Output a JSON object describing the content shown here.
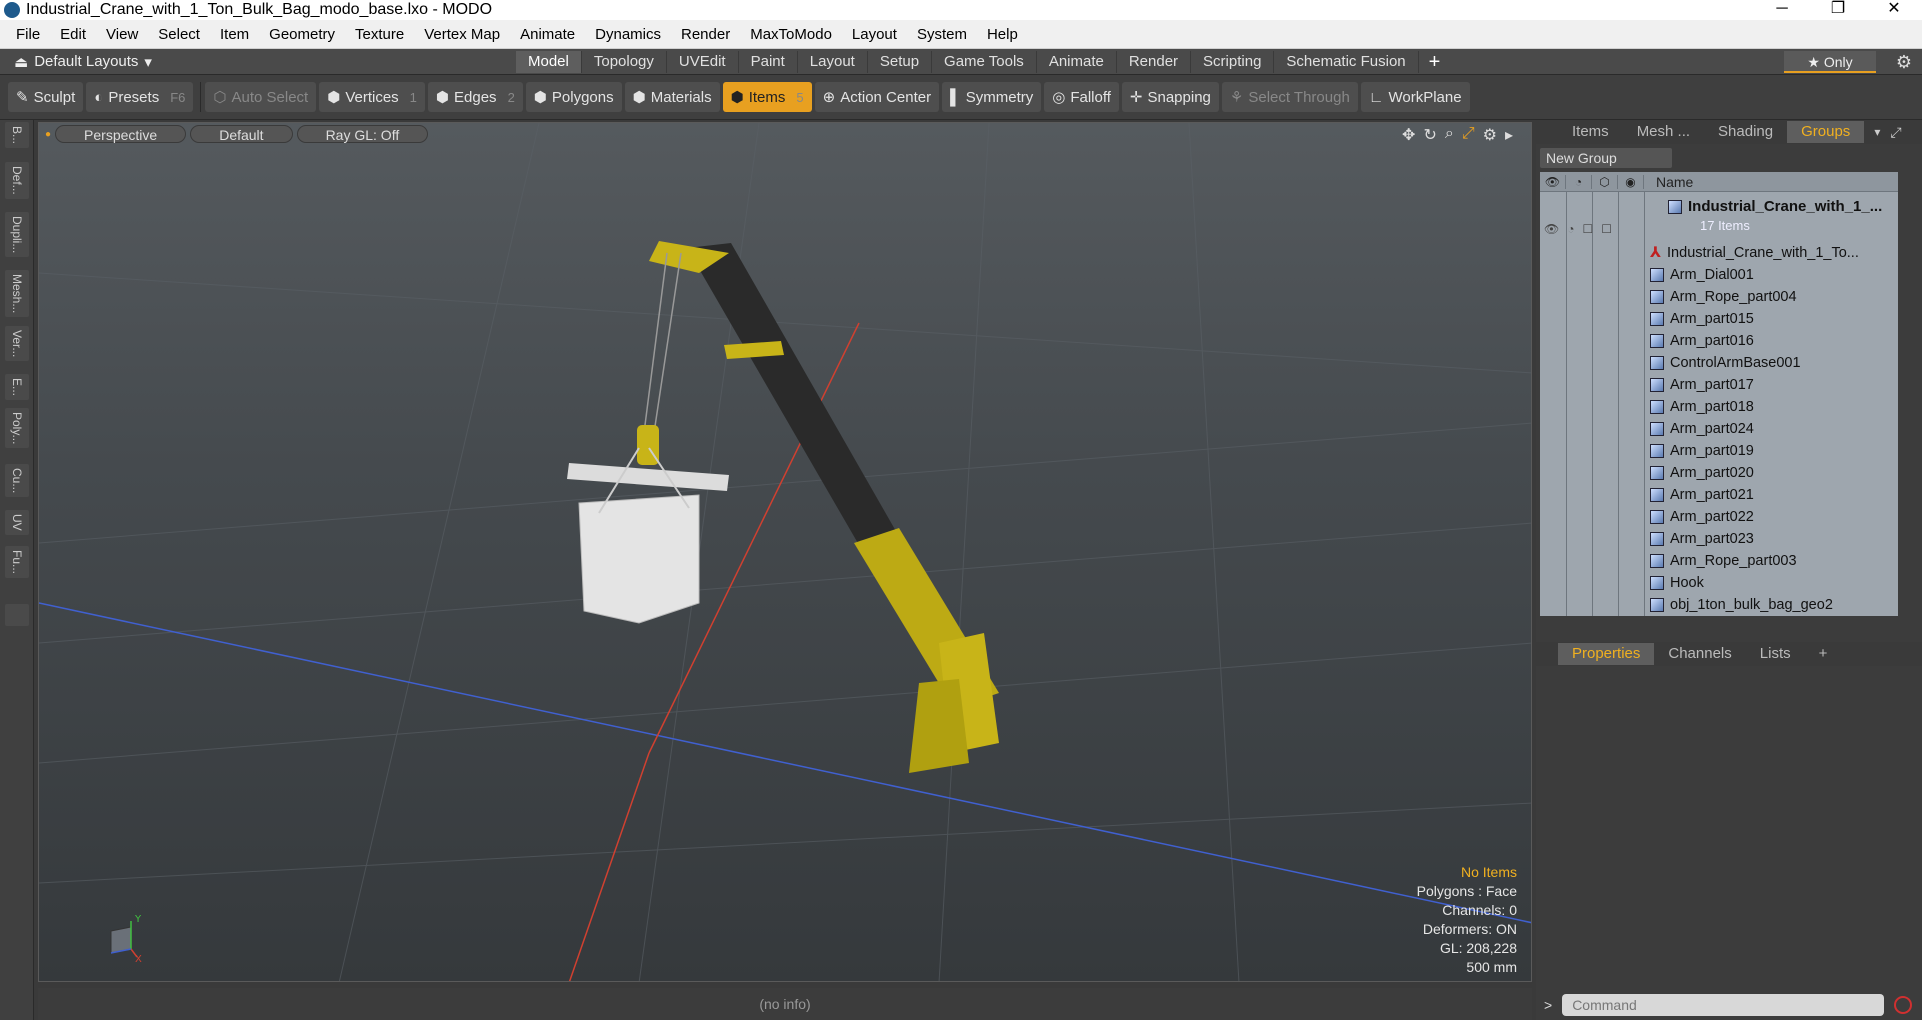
{
  "window": {
    "title": "Industrial_Crane_with_1_Ton_Bulk_Bag_modo_base.lxo - MODO",
    "minimize": "─",
    "maximize": "❐",
    "close": "✕"
  },
  "menu": [
    "File",
    "Edit",
    "View",
    "Select",
    "Item",
    "Geometry",
    "Texture",
    "Vertex Map",
    "Animate",
    "Dynamics",
    "Render",
    "MaxToModo",
    "Layout",
    "System",
    "Help"
  ],
  "layoutbar": {
    "layouts_label": "Default Layouts",
    "tabs": [
      "Model",
      "Topology",
      "UVEdit",
      "Paint",
      "Layout",
      "Setup",
      "Game Tools",
      "Animate",
      "Render",
      "Scripting",
      "Schematic Fusion"
    ],
    "active_tab": "Model",
    "plus": "+",
    "only_label": "★  Only"
  },
  "toolbar": {
    "sculpt": "Sculpt",
    "presets": "Presets",
    "presets_key": "F6",
    "auto_select": "Auto Select",
    "vertices": "Vertices",
    "vertices_key": "1",
    "edges": "Edges",
    "edges_key": "2",
    "polygons": "Polygons",
    "materials": "Materials",
    "items": "Items",
    "items_key": "5",
    "action_center": "Action Center",
    "symmetry": "Symmetry",
    "falloff": "Falloff",
    "snapping": "Snapping",
    "select_through": "Select Through",
    "workplane": "WorkPlane"
  },
  "left_tabs": [
    "B...",
    "Def...",
    "Dupli...",
    "Mesh...",
    "Ver...",
    "E...",
    "Poly...",
    "Cu...",
    "UV",
    "Fu..."
  ],
  "viewport": {
    "view": "Perspective",
    "shading": "Default",
    "raygl": "Ray GL: Off",
    "info": {
      "selection": "No Items",
      "polygons": "Polygons : Face",
      "channels": "Channels: 0",
      "deformers": "Deformers: ON",
      "gl": "GL: 208,228",
      "scale": "500 mm"
    },
    "axis_y": "Y",
    "axis_x": "X"
  },
  "status": "(no info)",
  "right_panel": {
    "tabs": [
      "Items",
      "Mesh ...",
      "Shading",
      "Groups"
    ],
    "active_tab": "Groups",
    "new_group": "New Group",
    "name_header": "Name",
    "root": "Industrial_Crane_with_1_...",
    "count": "17 Items",
    "items": [
      "Industrial_Crane_with_1_To...",
      "Arm_Dial001",
      "Arm_Rope_part004",
      "Arm_part015",
      "Arm_part016",
      "ControlArmBase001",
      "Arm_part017",
      "Arm_part018",
      "Arm_part024",
      "Arm_part019",
      "Arm_part020",
      "Arm_part021",
      "Arm_part022",
      "Arm_part023",
      "Arm_Rope_part003",
      "Hook",
      "obj_1ton_bulk_bag_geo2"
    ],
    "props_tabs": [
      "Properties",
      "Channels",
      "Lists"
    ],
    "props_active": "Properties",
    "props_plus": "+",
    "command_placeholder": "Command",
    "command_prompt": ">"
  },
  "colors": {
    "accent": "#e8a020",
    "crane_yellow": "#c8b418",
    "x_axis": "#d04030",
    "z_axis": "#4060d0"
  }
}
